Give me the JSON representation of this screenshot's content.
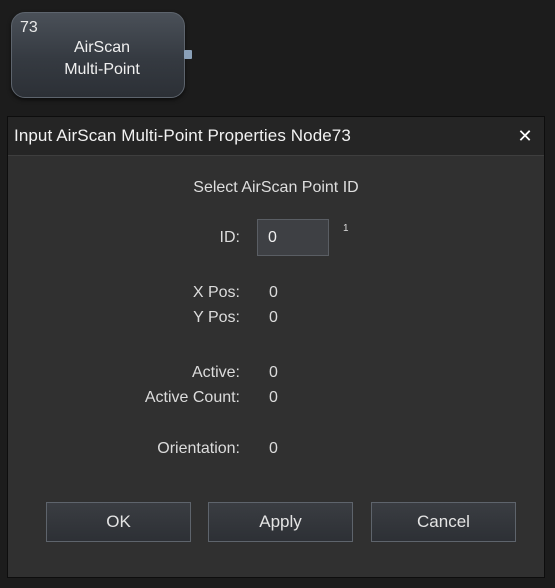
{
  "node": {
    "id": "73",
    "name_line1": "AirScan",
    "name_line2": "Multi-Point"
  },
  "dialog": {
    "title": "Input AirScan Multi-Point Properties Node73",
    "close_glyph": "✕",
    "heading": "Select AirScan Point ID",
    "id_label": "ID:",
    "id_value": "0",
    "id_superscript": "1",
    "fields": {
      "x_pos_label": "X Pos:",
      "x_pos_value": "0",
      "y_pos_label": "Y Pos:",
      "y_pos_value": "0",
      "active_label": "Active:",
      "active_value": "0",
      "active_count_label": "Active Count:",
      "active_count_value": "0",
      "orientation_label": "Orientation:",
      "orientation_value": "0"
    },
    "buttons": {
      "ok": "OK",
      "apply": "Apply",
      "cancel": "Cancel"
    }
  }
}
